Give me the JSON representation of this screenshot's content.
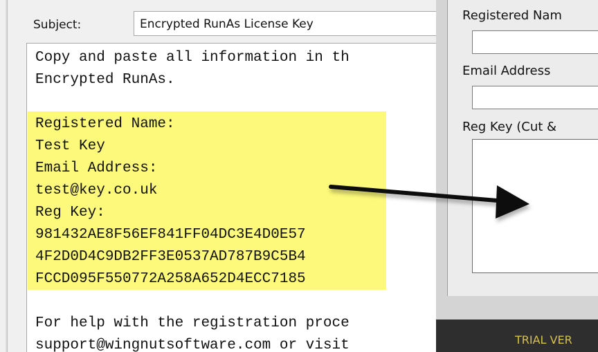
{
  "email": {
    "subject_label": "Subject:",
    "subject_value": "Encrypted RunAs License Key",
    "body_lines": [
      "Copy and paste all information in th",
      "Encrypted RunAs.",
      "",
      "Registered Name:",
      "Test Key",
      "Email Address:",
      "test@key.co.uk",
      "Reg Key:",
      "981432AE8F56EF841FF04DC3E4D0E57",
      "4F2D0D4C9DB2FF3E0537AD787B9C5B4",
      "FCCD095F550772A258A652D4ECC7185",
      "",
      "For help with the registration proce",
      "support@wingnutsoftware.com or visit"
    ]
  },
  "registration": {
    "name_label": "Registered Nam",
    "email_label": "Email Address",
    "regkey_label": "Reg Key (Cut &",
    "name_value": "",
    "email_value": "",
    "regkey_value": "",
    "trial_text": "TRIAL VER"
  },
  "colors": {
    "highlight": "#fdf97a",
    "trial_text": "#d8c24a",
    "arrow": "#111111"
  },
  "icons": {
    "arrow": "arrow-right-icon"
  }
}
